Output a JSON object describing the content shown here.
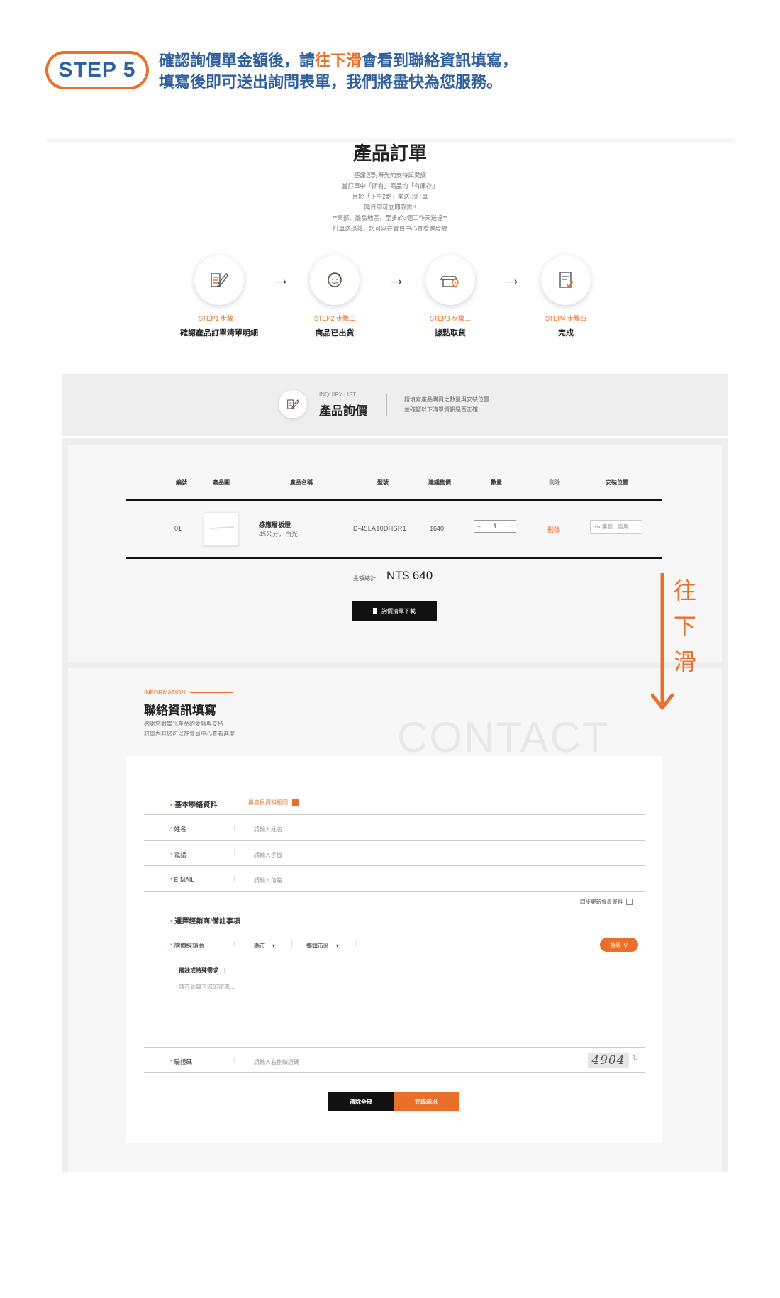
{
  "step": {
    "badge": "STEP 5",
    "line1_a": "確認詢價單金額後，請",
    "line1_hl": "往下滑",
    "line1_b": "會看到聯絡資訊填寫，",
    "line2": "填寫後即可送出詢問表單，我們將盡快為您服務。"
  },
  "order": {
    "title": "產品訂單",
    "notes": [
      "感謝您對舞光的支持與愛護",
      "當訂單中「所有」商品均「有庫存」",
      "且於「下午2點」前送出訂單",
      "隔日即可立即取貨!!",
      "**東部、離島地區，至多於3個工作天送達**",
      "訂單送出後，您可以在會員中心查看進度喔"
    ],
    "steps": [
      {
        "icon": "checklist-pen-icon",
        "step": "STEP1 步驟一",
        "name": "確認產品訂單清單明細"
      },
      {
        "icon": "headset-support-icon",
        "step": "STEP2 步驟二",
        "name": "商品已出貨"
      },
      {
        "icon": "store-location-icon",
        "step": "STEP3 步驟三",
        "name": "據點取貨"
      },
      {
        "icon": "document-check-icon",
        "step": "STEP4 步驟四",
        "name": "完成"
      }
    ],
    "arrow": "→"
  },
  "inquiry": {
    "en": "INQUIRY LIST",
    "title": "產品詢價",
    "desc1": "請填寫產品購買之數量與安裝位置",
    "desc2": "並確認以下清單資訊是否正確"
  },
  "table": {
    "headers": [
      "編號",
      "產品圖",
      "產品名稱",
      "型號",
      "建議售價",
      "數量",
      "刪除",
      "安裝位置"
    ],
    "rows": [
      {
        "no": "01",
        "name": "感應層板燈",
        "spec": "45公分，白光",
        "model": "D-45LA10DHSR1",
        "price": "$640",
        "qty": "1",
        "delete": "刪除",
        "location_placeholder": "ex:客廳、廚房..."
      }
    ],
    "qty_minus": "−",
    "qty_plus": "+",
    "total_label": "金額總計",
    "total_value": "NT$ 640",
    "download_label": "詢價清單下載"
  },
  "scroll_hint": [
    "往",
    "下",
    "滑"
  ],
  "contact": {
    "en": "INFORMATION",
    "title": "聯絡資訊填寫",
    "desc1": "感謝您對舞光產品的愛護與支持",
    "desc2": "訂單內容您可以在會員中心查看進度",
    "bg_word": "CONTACT",
    "basic_label": "基本聯絡資料",
    "same_member": "與會員資料相同",
    "fields": [
      {
        "label": "姓名",
        "placeholder": "請輸入姓名"
      },
      {
        "label": "電話",
        "placeholder": "請輸入手機"
      },
      {
        "label": "E-MAIL",
        "placeholder": "請輸入信箱"
      }
    ],
    "sync_label": "同步更新會員資料",
    "dealer_section": "選擇經銷商/備註事項",
    "dealer_label": "詢價經銷商",
    "city": "縣市",
    "district": "鄉鎮市區",
    "search_btn": "搜尋",
    "remark_label": "備註或特殊需求",
    "remark_placeholder": "請在此寫下您的需求...",
    "captcha_label": "驗證碼",
    "captcha_placeholder": "請輸入右側驗證碼",
    "captcha_code": "4904",
    "clear_btn": "清除全部",
    "submit_btn": "完成送出"
  }
}
